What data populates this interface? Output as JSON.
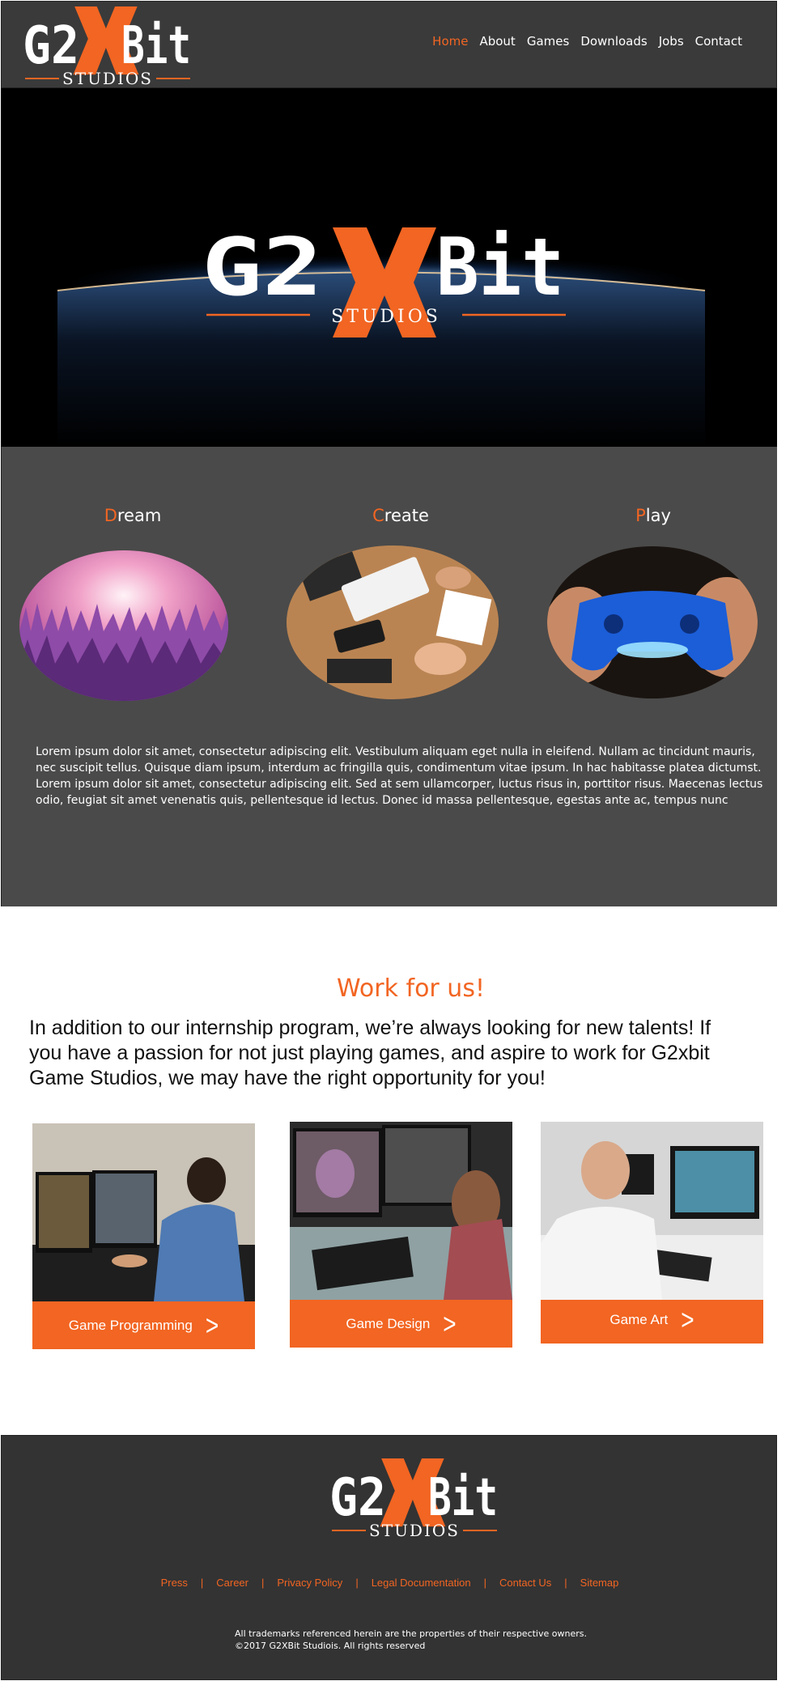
{
  "brand": {
    "logo_text_left": "G2",
    "logo_text_right": "Bit",
    "logo_sub": "STUDIOS",
    "accent": "#f26522"
  },
  "nav": {
    "items": [
      "Home",
      "About",
      "Games",
      "Downloads",
      "Jobs",
      "Contact"
    ]
  },
  "pillars": [
    {
      "first": "D",
      "rest": "ream"
    },
    {
      "first": "C",
      "rest": "reate"
    },
    {
      "first": "P",
      "rest": "lay"
    }
  ],
  "intro": {
    "text": "Lorem ipsum dolor sit amet, consectetur adipiscing elit. Vestibulum aliquam eget nulla in eleifend. Nullam ac tincidunt mauris, nec suscipit tellus. Quisque diam ipsum, interdum ac fringilla quis, condimentum vitae ipsum. In hac habitasse platea dictumst. Lorem ipsum dolor sit amet, consectetur adipiscing elit. Sed at sem ullamcorper, luctus risus in, porttitor risus. Maecenas lectus odio, feugiat sit amet venenatis quis, pellentesque id lectus. Donec id massa pellentesque, egestas ante ac, tempus nunc"
  },
  "work": {
    "title": "Work for us!",
    "text": "In addition to our internship program, we’re always looking for new talents! If you have a passion for not just playing games, and aspire to work for G2xbit Game Studios, we may have the right opportunity for you!",
    "jobs": [
      {
        "label": "Game Programming",
        "chevron": ">"
      },
      {
        "label": "Game Design",
        "chevron": ">"
      },
      {
        "label": "Game Art",
        "chevron": ">"
      }
    ]
  },
  "footer": {
    "links": [
      "Press",
      "Career",
      "Privacy Policy",
      "Legal Documentation",
      "Contact Us",
      "Sitemap"
    ],
    "separator": "|",
    "legal_line1": "All trademarks referenced herein are the properties of their respective owners.",
    "legal_line2": "©2017 G2XBit Studiois. All rights reserved"
  }
}
